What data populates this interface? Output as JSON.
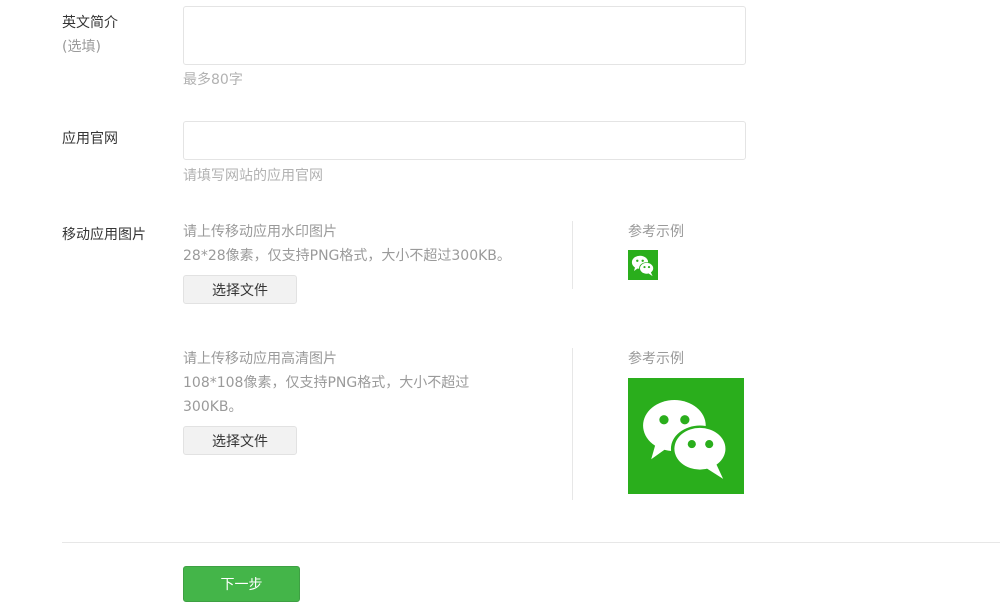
{
  "english_intro": {
    "label": "英文简介",
    "optional": "(选填)",
    "value": "",
    "hint": "最多80字"
  },
  "website": {
    "label": "应用官网",
    "value": "",
    "hint": "请填写网站的应用官网"
  },
  "mobile_images": {
    "label": "移动应用图片",
    "watermark": {
      "title": "请上传移动应用水印图片",
      "desc": "28*28像素，仅支持PNG格式，大小不超过300KB。",
      "button": "选择文件",
      "ref_label": "参考示例",
      "ref_icon": "wechat-icon"
    },
    "hd": {
      "title": "请上传移动应用高清图片",
      "desc": "108*108像素，仅支持PNG格式，大小不超过300KB。",
      "button": "选择文件",
      "ref_label": "参考示例",
      "ref_icon": "wechat-icon"
    }
  },
  "footer": {
    "next_button": "下一步"
  },
  "colors": {
    "primary_green": "#44b549",
    "wechat_green": "#2aae1c"
  }
}
